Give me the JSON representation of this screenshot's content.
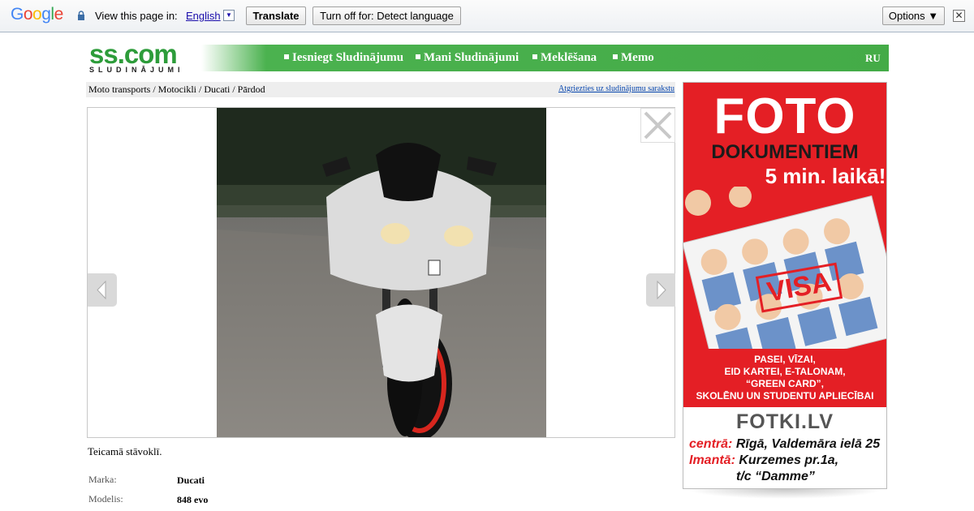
{
  "translate_bar": {
    "logo_letters": [
      "G",
      "o",
      "o",
      "g",
      "l",
      "e"
    ],
    "view_text": "View this page in:",
    "language": "English",
    "translate_label": "Translate",
    "turnoff_label": "Turn off for: Detect language",
    "options_label": "Options ▼",
    "close_glyph": "✕"
  },
  "header": {
    "logo_main": "ss.com",
    "logo_sub": "SLUDINĀJUMI",
    "nav": [
      "Iesniegt Sludinājumu",
      "Mani Sludinājumi",
      "Meklēšana",
      "Memo"
    ],
    "lang": "RU"
  },
  "breadcrumb": {
    "path": "Moto transports / Motocikli / Ducati / Pārdod",
    "back_link": "Atgriezties uz sludinājumu sarakstu"
  },
  "listing": {
    "description": "Teicamā stāvoklī.",
    "options": [
      {
        "label": "Marka:",
        "value": "Ducati"
      },
      {
        "label": "Modelis:",
        "value": "848 evo"
      }
    ]
  },
  "ad": {
    "title": "FOTO",
    "subtitle": "DOKUMENTIEM",
    "time": "5 min. laikā!",
    "stamp": "VISA",
    "lines": [
      "PASEI, VĪZAI,",
      "EID KARTEI, E-TALONAM,",
      "“GREEN CARD”,",
      "SKOLĒNU UN STUDENTU APLIECĪBAI"
    ],
    "brand": "FOTKI.LV",
    "addr1_label": "centrā:",
    "addr1": "Rīgā, Valdemāra ielā 25",
    "addr2_label": "Imantā:",
    "addr2": "Kurzemes pr.1a,",
    "addr3": "t/c “Damme”"
  },
  "colors": {
    "green": "#44ab47",
    "link": "#0645ad",
    "ad_red": "#e41f25"
  }
}
